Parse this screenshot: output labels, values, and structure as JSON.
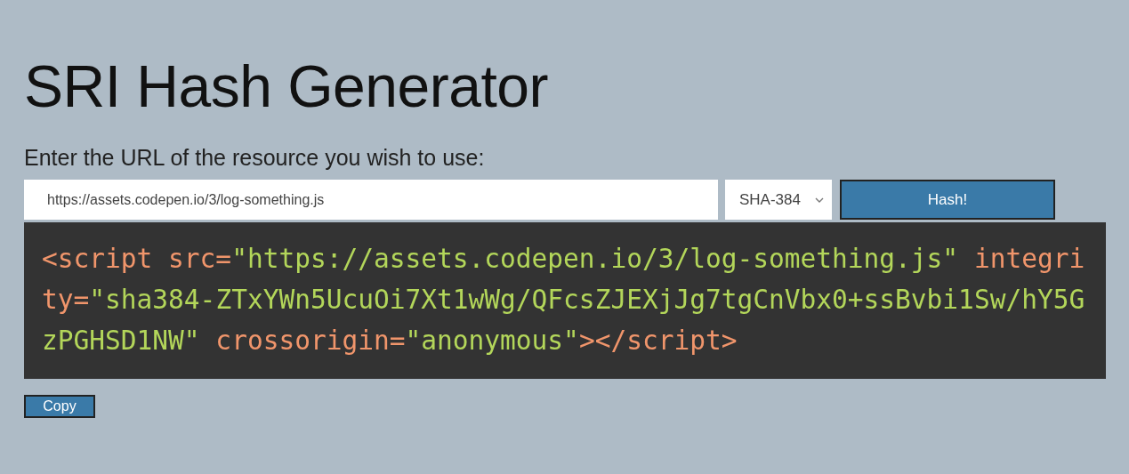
{
  "title": "SRI Hash Generator",
  "url_field": {
    "label": "Enter the URL of the resource you wish to use:",
    "value": "https://assets.codepen.io/3/log-something.js"
  },
  "algorithm_select": {
    "value": "SHA-384"
  },
  "hash_button": "Hash!",
  "output": {
    "tokens": [
      {
        "kind": "tag",
        "text": "<script"
      },
      {
        "kind": "attr",
        "text": " src="
      },
      {
        "kind": "string",
        "text": "\"https://assets.codepen.io/3/log-something.js\""
      },
      {
        "kind": "attr",
        "text": " integrity="
      },
      {
        "kind": "string",
        "text": "\"sha384-ZTxYWn5UcuOi7Xt1wWg/QFcsZJEXjJg7tgCnVbx0+ssBvbi1Sw/hY5GzPGHSD1NW\""
      },
      {
        "kind": "attr",
        "text": " crossorigin="
      },
      {
        "kind": "string",
        "text": "\"anonymous\""
      },
      {
        "kind": "tag",
        "text": "></script>"
      }
    ]
  },
  "copy_button": "Copy"
}
